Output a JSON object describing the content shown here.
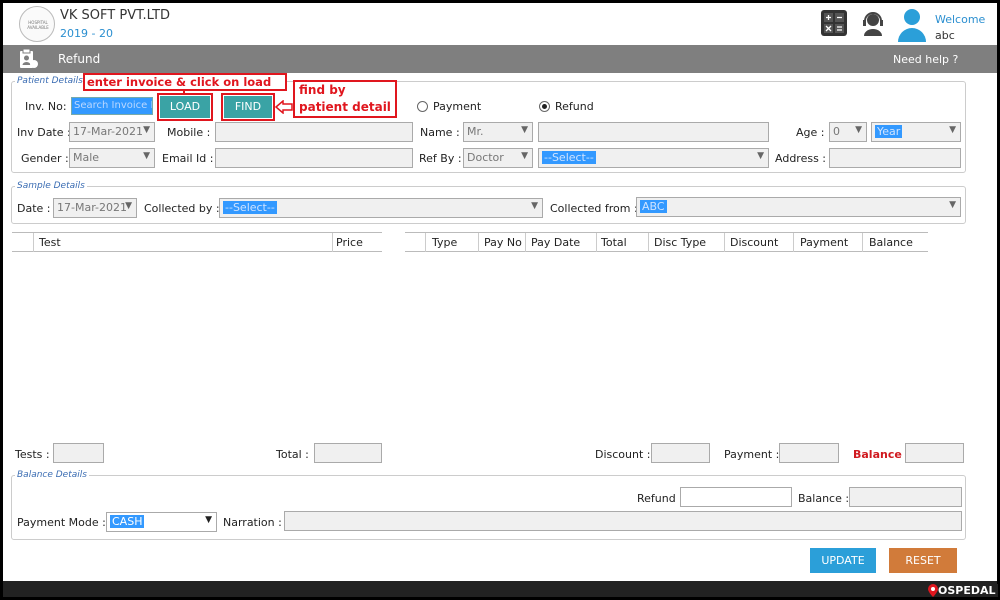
{
  "app": {
    "company": "VK SOFT PVT.LTD",
    "year": "2019 - 20",
    "logo_text": "HOSPITAL AVAILABLE",
    "welcome": "Welcome",
    "user": "abc"
  },
  "titlebar": {
    "title": "Refund",
    "help": "Need help ?"
  },
  "patient": {
    "group_title": "Patient Details",
    "inv_no_label": "Inv. No:",
    "inv_no_placeholder": "Search Invoice No",
    "load_label": "LOAD",
    "find_label": "FIND",
    "payment_radio": "Payment",
    "refund_radio": "Refund",
    "inv_date_label": "Inv Date :",
    "inv_date_value": "17-Mar-2021",
    "mobile_label": "Mobile :",
    "name_label": "Name :",
    "name_title": "Mr.",
    "age_label": "Age :",
    "age_value": "0",
    "age_unit": "Year",
    "gender_label": "Gender :",
    "gender_value": "Male",
    "email_label": "Email Id :",
    "refby_label": "Ref By :",
    "refby_value": "Doctor",
    "refby_select": "--Select--",
    "address_label": "Address :"
  },
  "annotations": {
    "load_hint": "enter invoice & click on load",
    "find_hint_line1": "find by",
    "find_hint_line2": "patient detail"
  },
  "sample": {
    "group_title": "Sample Details",
    "date_label": "Date :",
    "date_value": "17-Mar-2021",
    "collected_by_label": "Collected by :",
    "collected_by_value": "--Select--",
    "collected_from_label": "Collected from :",
    "collected_from_value": "ABC"
  },
  "test_table": {
    "columns": [
      "Test",
      "Price"
    ]
  },
  "payment_table": {
    "columns": [
      "Type",
      "Pay No",
      "Pay Date",
      "Total",
      "Disc Type",
      "Discount",
      "Payment",
      "Balance"
    ]
  },
  "totals": {
    "tests_label": "Tests :",
    "total_label": "Total :",
    "discount_label": "Discount :",
    "payment_label": "Payment :",
    "balance_label": "Balance :"
  },
  "balance": {
    "group_title": "Balance Details",
    "refund_label": "Refund",
    "balance_label": "Balance :",
    "payment_mode_label": "Payment Mode :",
    "payment_mode_value": "CASH",
    "narration_label": "Narration :"
  },
  "actions": {
    "update_label": "UPDATE",
    "reset_label": "RESET"
  },
  "brand": {
    "footer_logo": "OSPEDAL"
  },
  "colors": {
    "accent_blue": "#2b9fd9",
    "teal": "#3aa3a5",
    "orange": "#d17b3a",
    "annotation_red": "#e0161e",
    "titlebar_gray": "#7f7f7f"
  }
}
